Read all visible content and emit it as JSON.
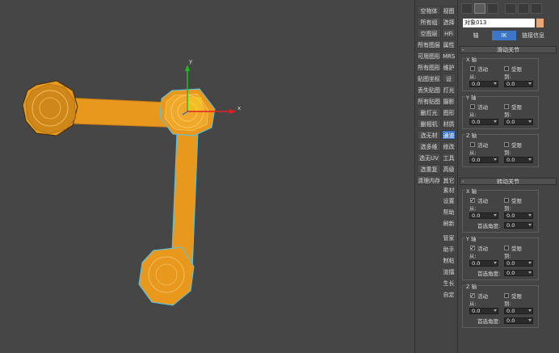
{
  "toolbar_buttons": [
    {
      "label": "空物体",
      "row": 0
    },
    {
      "label": "视图",
      "row": 0
    },
    {
      "label": "所有组",
      "row": 1
    },
    {
      "label": "选择",
      "row": 1
    },
    {
      "label": "空图层",
      "row": 2
    },
    {
      "label": "HFi",
      "row": 2
    },
    {
      "label": "所有图层",
      "row": 3
    },
    {
      "label": "属性",
      "row": 3
    },
    {
      "label": "可用图形",
      "row": 4
    },
    {
      "label": "MRS",
      "row": 4
    },
    {
      "label": "所有图形",
      "row": 5
    },
    {
      "label": "维护",
      "row": 5
    },
    {
      "label": "贴图坐标",
      "row": 6
    },
    {
      "label": "设",
      "row": 6
    },
    {
      "label": "丢失贴图",
      "row": 7
    },
    {
      "label": "灯光",
      "row": 7
    },
    {
      "label": "所有贴图",
      "row": 8
    },
    {
      "label": "摄影",
      "row": 8
    },
    {
      "label": "删灯光",
      "row": 9
    },
    {
      "label": "图形",
      "row": 9
    },
    {
      "label": "删相机",
      "row": 10
    },
    {
      "label": "材质",
      "row": 10
    },
    {
      "label": "选无材",
      "row": 11
    },
    {
      "label": "通道",
      "row": 11
    },
    {
      "label": "选多维",
      "row": 12
    },
    {
      "label": "修改",
      "row": 12
    },
    {
      "label": "选无UV",
      "row": 13
    },
    {
      "label": "工具",
      "row": 13
    },
    {
      "label": "选重复",
      "row": 14
    },
    {
      "label": "高级",
      "row": 14
    },
    {
      "label": "清理内存",
      "row": 15
    },
    {
      "label": "其它",
      "row": 15
    }
  ],
  "side_links": [
    "素材",
    "设置",
    "帮助",
    "刷新",
    "管家",
    "助手",
    "制粘",
    "渲擂",
    "生长",
    "自定"
  ],
  "panel": {
    "object_name": "对象013",
    "swatch_color": "#e8a575",
    "modes": [
      "轴",
      "IK",
      "链接信息"
    ],
    "active_mode": "IK",
    "sliding_rollout": {
      "title": "滑动关节",
      "axes": [
        {
          "name": "X 轴",
          "active_label": "活动",
          "limited_label": "受限",
          "from_label": "从:",
          "to_label": "到:",
          "from": "0.0",
          "to": "0.0",
          "active": false
        },
        {
          "name": "Y 轴",
          "active_label": "活动",
          "limited_label": "受限",
          "from_label": "从:",
          "to_label": "到:",
          "from": "0.0",
          "to": "0.0",
          "active": false
        },
        {
          "name": "Z 轴",
          "active_label": "活动",
          "limited_label": "受限",
          "from_label": "从:",
          "to_label": "到:",
          "from": "0.0",
          "to": "0.0",
          "active": false
        }
      ]
    },
    "rotation_rollout": {
      "title": "转动关节",
      "axes": [
        {
          "name": "X 轴",
          "active_label": "活动",
          "limited_label": "受限",
          "from_label": "从:",
          "to_label": "到:",
          "from": "0.0",
          "to": "0.0",
          "pref_label": "首选角度:",
          "pref": "0.0",
          "active": true
        },
        {
          "name": "Y 轴",
          "active_label": "活动",
          "limited_label": "受限",
          "from_label": "从:",
          "to_label": "到:",
          "from": "0.0",
          "to": "0.0",
          "pref_label": "首选角度:",
          "pref": "0.0",
          "active": true
        },
        {
          "name": "Z 轴",
          "active_label": "活动",
          "limited_label": "受限",
          "from_label": "从:",
          "to_label": "到:",
          "from": "0.0",
          "to": "0.0",
          "pref_label": "首选角度:",
          "pref": "0.0",
          "active": true
        }
      ]
    }
  },
  "gizmo": {
    "x_label": "x",
    "y_label": "y"
  },
  "colors": {
    "object": "#e8981c",
    "selection": "#4fc8f0",
    "x_axis": "#e02020",
    "y_axis": "#20c020",
    "z_axis": "#2060e0",
    "highlight_button": "#3d76c6"
  }
}
